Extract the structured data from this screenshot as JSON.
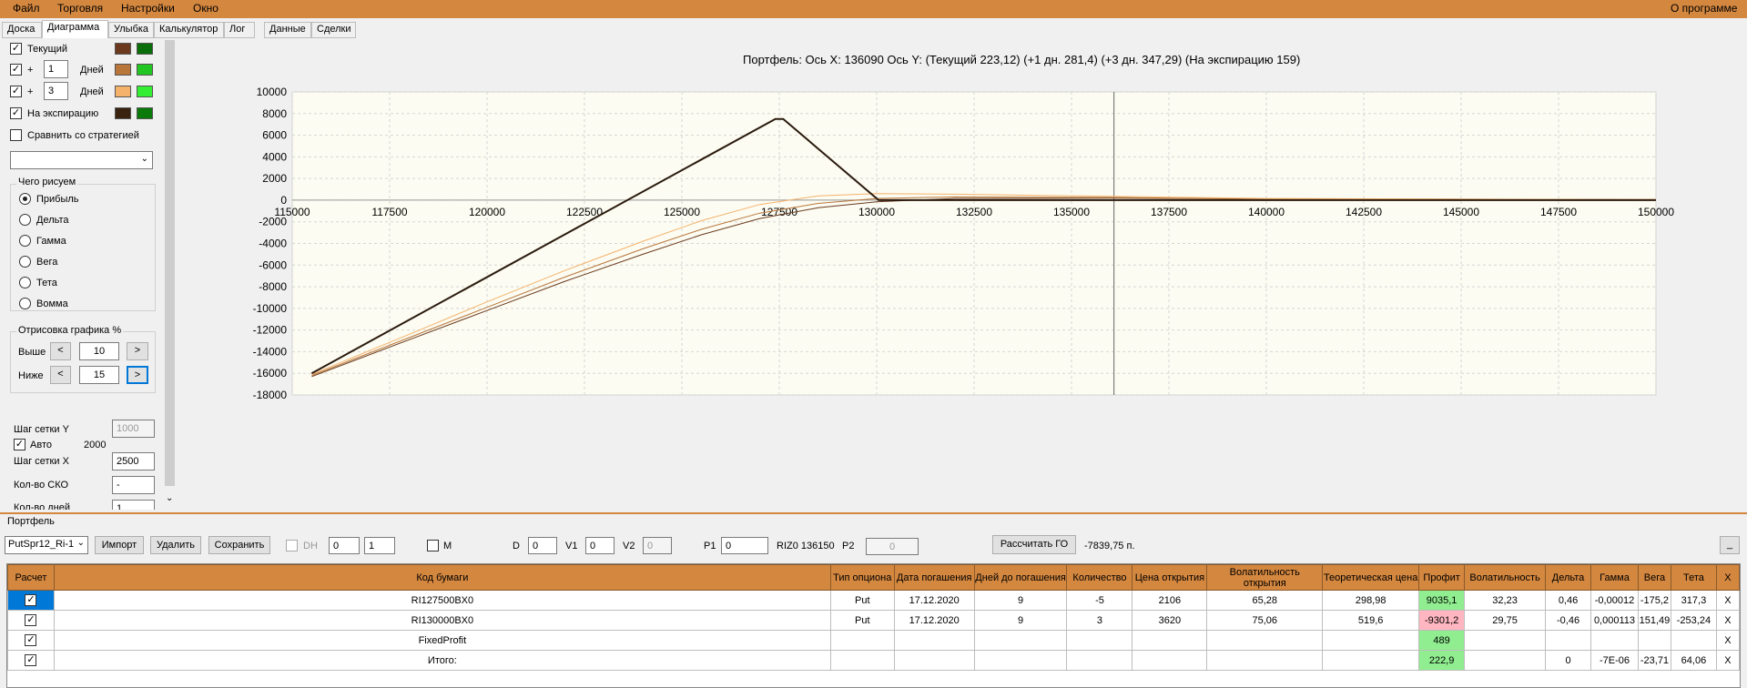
{
  "menu": {
    "file": "Файл",
    "trade": "Торговля",
    "settings": "Настройки",
    "window": "Окно",
    "about": "О программе"
  },
  "tabs": [
    "Доска",
    "Диаграмма",
    "Улыбка",
    "Калькулятор",
    "Лог",
    "Данные",
    "Сделки"
  ],
  "left": {
    "current": "Текущий",
    "plus": "+",
    "days": "Дней",
    "days1": "1",
    "days3": "3",
    "expiry": "На экспирацию",
    "compare": "Сравнить со стратегией",
    "what_title": "Чего рисуем",
    "modes": [
      "Прибыль",
      "Дельта",
      "Гамма",
      "Вега",
      "Тета",
      "Вомма"
    ],
    "draw_title": "Отрисовка графика %",
    "above": "Выше",
    "below": "Ниже",
    "above_val": "10",
    "below_val": "15",
    "lt": "<",
    "gt": ">",
    "grid_y": "Шаг сетки Y",
    "grid_y_val": "1000",
    "auto": "Авто",
    "auto_val": "2000",
    "grid_x": "Шаг сетки X",
    "grid_x_val": "2500",
    "sko": "Кол-во СКО",
    "sko_val": "-",
    "ndays": "Кол-во дней",
    "ndays_val": "1",
    "colors": {
      "cur1": "#6b3a1e",
      "cur2": "#0a6e0a",
      "d1a": "#b8763a",
      "d1b": "#22c622",
      "d3a": "#f5b26b",
      "d3b": "#33ee33",
      "ea": "#3a2210",
      "eb": "#0a7a0a"
    }
  },
  "chart_data": {
    "type": "line",
    "title": "Портфель: Ось X: 136090 Ось Y:  (Текущий 223,12)  (+1 дн. 281,4)  (+3 дн. 347,29)  (На экспирацию 159)",
    "xlim": [
      115000,
      150000
    ],
    "ylim": [
      -18000,
      10000
    ],
    "xticks": [
      115000,
      117500,
      120000,
      122500,
      125000,
      127500,
      130000,
      132500,
      135000,
      137500,
      140000,
      142500,
      145000,
      147500,
      150000
    ],
    "yticks": [
      10000,
      8000,
      6000,
      4000,
      2000,
      0,
      -2000,
      -4000,
      -6000,
      -8000,
      -10000,
      -12000,
      -14000,
      -16000,
      -18000
    ],
    "cursor_x": 136090,
    "series": [
      {
        "color": "#2b1a0e",
        "width": 2,
        "points": [
          [
            115500,
            -16000
          ],
          [
            127400,
            7500
          ],
          [
            127600,
            7500
          ],
          [
            130050,
            0
          ],
          [
            150000,
            0
          ]
        ]
      },
      {
        "color": "#f5b26b",
        "width": 1,
        "points": [
          [
            115500,
            -16100
          ],
          [
            118000,
            -12400
          ],
          [
            120000,
            -9400
          ],
          [
            122000,
            -6500
          ],
          [
            124000,
            -3800
          ],
          [
            125500,
            -1900
          ],
          [
            127000,
            -400
          ],
          [
            128500,
            400
          ],
          [
            130000,
            600
          ],
          [
            132000,
            550
          ],
          [
            136000,
            350
          ],
          [
            140000,
            150
          ],
          [
            150000,
            50
          ]
        ]
      },
      {
        "color": "#b8763a",
        "width": 1,
        "points": [
          [
            115500,
            -16200
          ],
          [
            118000,
            -12700
          ],
          [
            120000,
            -9900
          ],
          [
            122000,
            -7100
          ],
          [
            124000,
            -4500
          ],
          [
            125500,
            -2700
          ],
          [
            127000,
            -1200
          ],
          [
            128500,
            -300
          ],
          [
            130000,
            150
          ],
          [
            132000,
            300
          ],
          [
            136000,
            250
          ],
          [
            140000,
            120
          ],
          [
            150000,
            50
          ]
        ]
      },
      {
        "color": "#6b3a1e",
        "width": 1,
        "points": [
          [
            115500,
            -16300
          ],
          [
            118000,
            -12900
          ],
          [
            120000,
            -10200
          ],
          [
            122000,
            -7500
          ],
          [
            124000,
            -5000
          ],
          [
            125500,
            -3200
          ],
          [
            127000,
            -1700
          ],
          [
            128500,
            -700
          ],
          [
            130000,
            -150
          ],
          [
            132000,
            150
          ],
          [
            136000,
            200
          ],
          [
            140000,
            100
          ],
          [
            150000,
            40
          ]
        ]
      }
    ]
  },
  "portfolio": {
    "label": "Портфель",
    "selected": "PutSpr12_Ri-1",
    "import": "Импорт",
    "delete": "Удалить",
    "save": "Сохранить",
    "dh": "DH",
    "dh1": "0",
    "dh2": "1",
    "m": "M",
    "d": "D",
    "d_val": "0",
    "v1": "V1",
    "v1_val": "0",
    "v2": "V2",
    "v2_val": "0",
    "p1": "P1",
    "p1_val": "0",
    "riz": "RIZ0 136150",
    "p2": "P2",
    "p2_val": "0",
    "calc": "Рассчитать ГО",
    "go_val": "-7839,75 п.",
    "min": "_"
  },
  "table": {
    "headers": [
      "Расчет",
      "Код бумаги",
      "Тип опциона",
      "Дата погашения",
      "Дней до погашения",
      "Количество",
      "Цена открытия",
      "Волатильность открытия",
      "Теоретическая цена",
      "Профит",
      "Волатильность",
      "Дельта",
      "Гамма",
      "Вега",
      "Тета",
      "X"
    ],
    "rows": [
      [
        "✓",
        "RI127500BX0",
        "Put",
        "17.12.2020",
        "9",
        "-5",
        "2106",
        "65,28",
        "298,98",
        "9035,1",
        "32,23",
        "0,46",
        "-0,00012",
        "-175,2",
        "317,3",
        "X"
      ],
      [
        "✓",
        "RI130000BX0",
        "Put",
        "17.12.2020",
        "9",
        "3",
        "3620",
        "75,06",
        "519,6",
        "-9301,2",
        "29,75",
        "-0,46",
        "0,000113",
        "151,49",
        "-253,24",
        "X"
      ],
      [
        "✓",
        "FixedProfit",
        "",
        "",
        "",
        "",
        "",
        "",
        "",
        "489",
        "",
        "",
        "",
        "",
        "",
        "X"
      ],
      [
        "✓",
        "Итого:",
        "",
        "",
        "",
        "",
        "",
        "",
        "",
        "222,9",
        "",
        "0",
        "-7E-06",
        "-23,71",
        "64,06",
        "X"
      ]
    ]
  }
}
